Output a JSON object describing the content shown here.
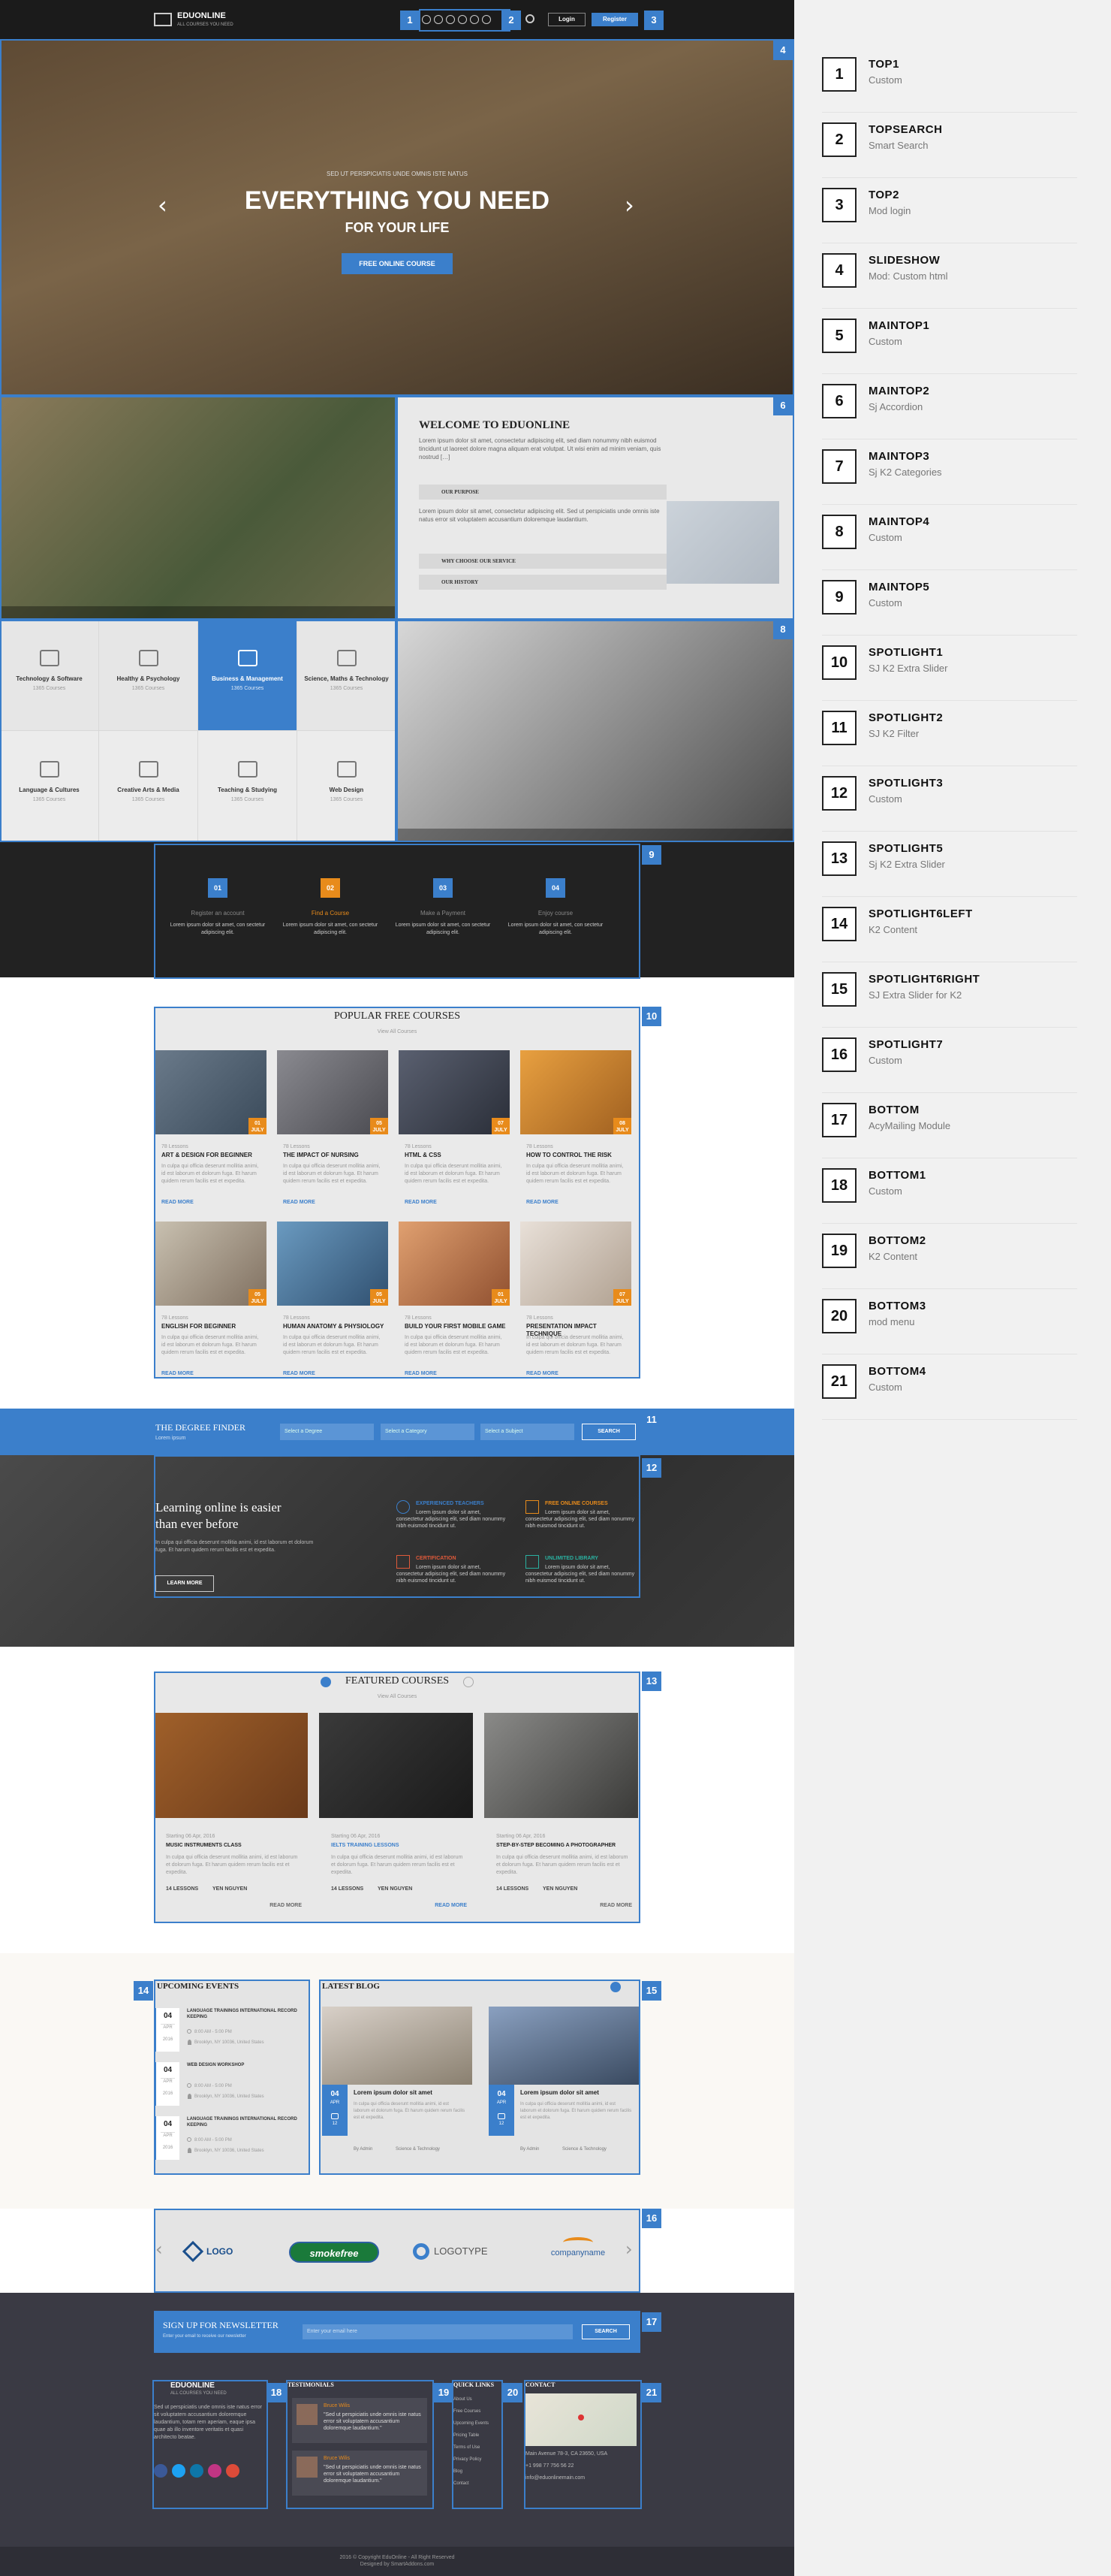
{
  "header": {
    "logo": "EDUONLINE",
    "tagline": "ALL COURSES YOU NEED",
    "login": "Login",
    "register": "Register"
  },
  "hero": {
    "kicker": "SED UT PERSPICIATIS UNDE OMNIS ISTE NATUS",
    "title": "EVERYTHING YOU NEED",
    "subtitle": "FOR YOUR LIFE",
    "cta": "FREE ONLINE COURSE"
  },
  "welcome": {
    "title": "WELCOME TO EDUONLINE",
    "text": "Lorem ipsum dolor sit amet, consectetur adipiscing elit, sed diam nonummy nibh euismod tincidunt ut laoreet dolore magna aliquam erat volutpat. Ut wisi enim ad minim veniam, quis nostrud […]",
    "acc1": "OUR PURPOSE",
    "acc2": "WHY CHOOSE OUR SERVICE",
    "acc3": "OUR HISTORY",
    "text2": "Lorem ipsum dolor sit amet, consectetur adipiscing elit. Sed ut perspiciatis unde omnis iste natus error sit voluptatem accusantium doloremque laudantium."
  },
  "categories": [
    {
      "name": "Technology & Software",
      "count": "1365 Courses"
    },
    {
      "name": "Healthy & Psychology",
      "count": "1365 Courses"
    },
    {
      "name": "Business & Management",
      "count": "1365 Courses"
    },
    {
      "name": "Science, Maths & Technology",
      "count": "1365 Courses"
    },
    {
      "name": "Language & Cultures",
      "count": "1365 Courses"
    },
    {
      "name": "Creative Arts & Media",
      "count": "1365 Courses"
    },
    {
      "name": "Teaching & Studying",
      "count": "1365 Courses"
    },
    {
      "name": "Web Design",
      "count": "1365 Courses"
    }
  ],
  "steps": [
    {
      "n": "01",
      "title": "Register an account",
      "text": "Lorem ipsum dolor sit amet, con sectetur adipiscing elit."
    },
    {
      "n": "02",
      "title": "Find a Course",
      "text": "Lorem ipsum dolor sit amet, con sectetur adipiscing elit."
    },
    {
      "n": "03",
      "title": "Make a Payment",
      "text": "Lorem ipsum dolor sit amet, con sectetur adipiscing elit."
    },
    {
      "n": "04",
      "title": "Enjoy course",
      "text": "Lorem ipsum dolor sit amet, con sectetur adipiscing elit."
    }
  ],
  "popular": {
    "title": "POPULAR FREE COURSES",
    "sub": "View All Courses",
    "read": "READ MORE",
    "meta": "78 Lessons",
    "desc": "In culpa qui officia deserunt mollitia animi, id est laborum et dolorum fuga. Et harum quidem rerum facilis est et expedita.",
    "courses": [
      "ART & DESIGN FOR BEGINNER",
      "THE IMPACT OF NURSING",
      "HTML & CSS",
      "HOW TO CONTROL THE RISK",
      "ENGLISH FOR BEGINNER",
      "HUMAN ANATOMY & PHYSIOLOGY",
      "BUILD YOUR FIRST MOBILE GAME",
      "PRESENTATION IMPACT TECHNIQUE"
    ],
    "tags": [
      "01 JULY",
      "05 JULY",
      "07 JULY",
      "08 JULY",
      "05 JULY",
      "05 JULY",
      "01 JULY",
      "07 JULY"
    ]
  },
  "finder": {
    "title": "THE DEGREE FINDER",
    "sub": "Lorem ipsum",
    "sel1": "Select a Degree",
    "sel2": "Select a Category",
    "sel3": "Select a Subject",
    "btn": "SEARCH"
  },
  "learning": {
    "title1": "Learning online is easier",
    "title2": "than ever before",
    "text": "In culpa qui officia deserunt mollitia animi, id est laborum et dolorum fuga. Et harum quidem rerum facilis est et expedita.",
    "btn": "LEARN MORE",
    "f1": "EXPERIENCED TEACHERS",
    "f2": "FREE ONLINE COURSES",
    "f3": "CERTIFICATION",
    "f4": "UNLIMITED LIBRARY",
    "ftext": "Lorem ipsum dolor sit amet, consectetur adipiscing elit, sed diam nonummy nibh euismod tincidunt ut."
  },
  "featured": {
    "title": "FEATURED COURSES",
    "sub": "View All Courses",
    "date": "Starting 06 Apr, 2016",
    "c1": "MUSIC INSTRUMENTS CLASS",
    "c2": "IELTS TRAINING LESSONS",
    "c3": "STEP-BY-STEP BECOMING A PHOTOGRAPHER",
    "desc": "In culpa qui officia deserunt mollitia animi, id est laborum et dolorum fuga. Et harum quidem rerum facilis est et expedita.",
    "lessons": "14 LESSONS",
    "teacher": "YEN NGUYEN",
    "read": "READ MORE"
  },
  "events": {
    "title": "UPCOMING EVENTS",
    "items": [
      {
        "d": "04",
        "m": "APR",
        "y": "2016",
        "t": "LANGUAGE TRAININGS INTERNATIONAL RECORD KEEPING",
        "time": "8:00 AM - 5:00 PM",
        "loc": "Brooklyn, NY 10036, United States"
      },
      {
        "d": "04",
        "m": "APR",
        "y": "2016",
        "t": "WEB DESIGN WORKSHOP",
        "time": "8:00 AM - 5:00 PM",
        "loc": "Brooklyn, NY 10036, United States"
      },
      {
        "d": "04",
        "m": "APR",
        "y": "2016",
        "t": "LANGUAGE TRAININGS INTERNATIONAL RECORD KEEPING",
        "time": "8:00 AM - 5:00 PM",
        "loc": "Brooklyn, NY 10036, United States"
      }
    ]
  },
  "blog": {
    "title": "LATEST BLOG",
    "items": [
      {
        "d": "04",
        "m": "APR",
        "t": "Lorem ipsum dolor sit amet",
        "x": "In culpa qui officia deserunt mollitia animi, id est laborum et dolorum fuga. Et harum quidem rerum facilis est et expedita.",
        "a": "By Admin",
        "c": "Science & Technology",
        "cm": "12"
      },
      {
        "d": "04",
        "m": "APR",
        "t": "Lorem ipsum dolor sit amet",
        "x": "In culpa qui officia deserunt mollitia animi, id est laborum et dolorum fuga. Et harum quidem rerum facilis est et expedita.",
        "a": "By Admin",
        "c": "Science & Technology",
        "cm": "12"
      }
    ]
  },
  "logos": [
    "LOGO",
    "smokefree",
    "LOGOTYPE",
    "companyname"
  ],
  "newsletter": {
    "title": "SIGN UP FOR NEWSLETTER",
    "sub": "Enter your email to receive our newsletter",
    "placeholder": "Enter your email here",
    "btn": "SEARCH"
  },
  "footer": {
    "logo": "EDUONLINE",
    "tagline": "ALL COURSES YOU NEED",
    "about": "Sed ut perspiciatis unde omnis iste natus error sit voluptatem accusantium doloremque laudantium, totam rem aperiam, eaque ipsa quae ab illo inventore veritatis et quasi architecto beatae.",
    "testimonials": "TESTIMONIALS",
    "t1name": "Bruce Wilis",
    "t1role": "Teacher",
    "t1quote": "\"Sed ut perspiciatis unde omnis iste natus error sit voluptatem accusantium doloremque laudantium.\"",
    "t2name": "Bruce Wilis",
    "t2role": "Teacher",
    "t2quote": "\"Sed ut perspiciatis unde omnis iste natus error sit voluptatem accusantium doloremque laudantium.\"",
    "quick": "QUICK LINKS",
    "links": [
      "About Us",
      "Free Courses",
      "Upcoming Events",
      "Pricing Table",
      "Terms of Use",
      "Privacy Policy",
      "Blog",
      "Contact"
    ],
    "contact": "CONTACT",
    "addr": "Main Avenue 78-3, CA 23650, USA",
    "phone": "+1 998 77 756 56 22",
    "email": "info@eduonlinemain.com",
    "copy": "2016 © Copyright EduOnline - All Right Reserved",
    "design": "Designed by SmartAddons.com"
  },
  "legend": [
    {
      "n": "1",
      "t": "TOP1",
      "s": "Custom"
    },
    {
      "n": "2",
      "t": "TOPSEARCH",
      "s": "Smart Search"
    },
    {
      "n": "3",
      "t": "TOP2",
      "s": "Mod login"
    },
    {
      "n": "4",
      "t": "SLIDESHOW",
      "s": "Mod: Custom html"
    },
    {
      "n": "5",
      "t": "MAINTOP1",
      "s": "Custom"
    },
    {
      "n": "6",
      "t": "MAINTOP2",
      "s": "Sj Accordion"
    },
    {
      "n": "7",
      "t": "MAINTOP3",
      "s": "Sj K2 Categories"
    },
    {
      "n": "8",
      "t": "MAINTOP4",
      "s": "Custom"
    },
    {
      "n": "9",
      "t": "MAINTOP5",
      "s": "Custom"
    },
    {
      "n": "10",
      "t": "SPOTLIGHT1",
      "s": "SJ K2 Extra Slider"
    },
    {
      "n": "11",
      "t": "SPOTLIGHT2",
      "s": "SJ K2 Filter"
    },
    {
      "n": "12",
      "t": "SPOTLIGHT3",
      "s": "Custom"
    },
    {
      "n": "13",
      "t": "SPOTLIGHT5",
      "s": "Sj K2 Extra Slider"
    },
    {
      "n": "14",
      "t": "SPOTLIGHT6LEFT",
      "s": "K2 Content"
    },
    {
      "n": "15",
      "t": "SPOTLIGHT6RIGHT",
      "s": "SJ Extra Slider for K2"
    },
    {
      "n": "16",
      "t": "SPOTLIGHT7",
      "s": "Custom"
    },
    {
      "n": "17",
      "t": "BOTTOM",
      "s": "AcyMailing Module"
    },
    {
      "n": "18",
      "t": "BOTTOM1",
      "s": "Custom"
    },
    {
      "n": "19",
      "t": "BOTTOM2",
      "s": "K2 Content"
    },
    {
      "n": "20",
      "t": "BOTTOM3",
      "s": "mod menu"
    },
    {
      "n": "21",
      "t": "BOTTOM4",
      "s": "Custom"
    }
  ],
  "colors": {
    "accent": "#3b7fcb",
    "orange": "#e88b1b",
    "dark": "#222222",
    "footer": "#3a3a44"
  }
}
